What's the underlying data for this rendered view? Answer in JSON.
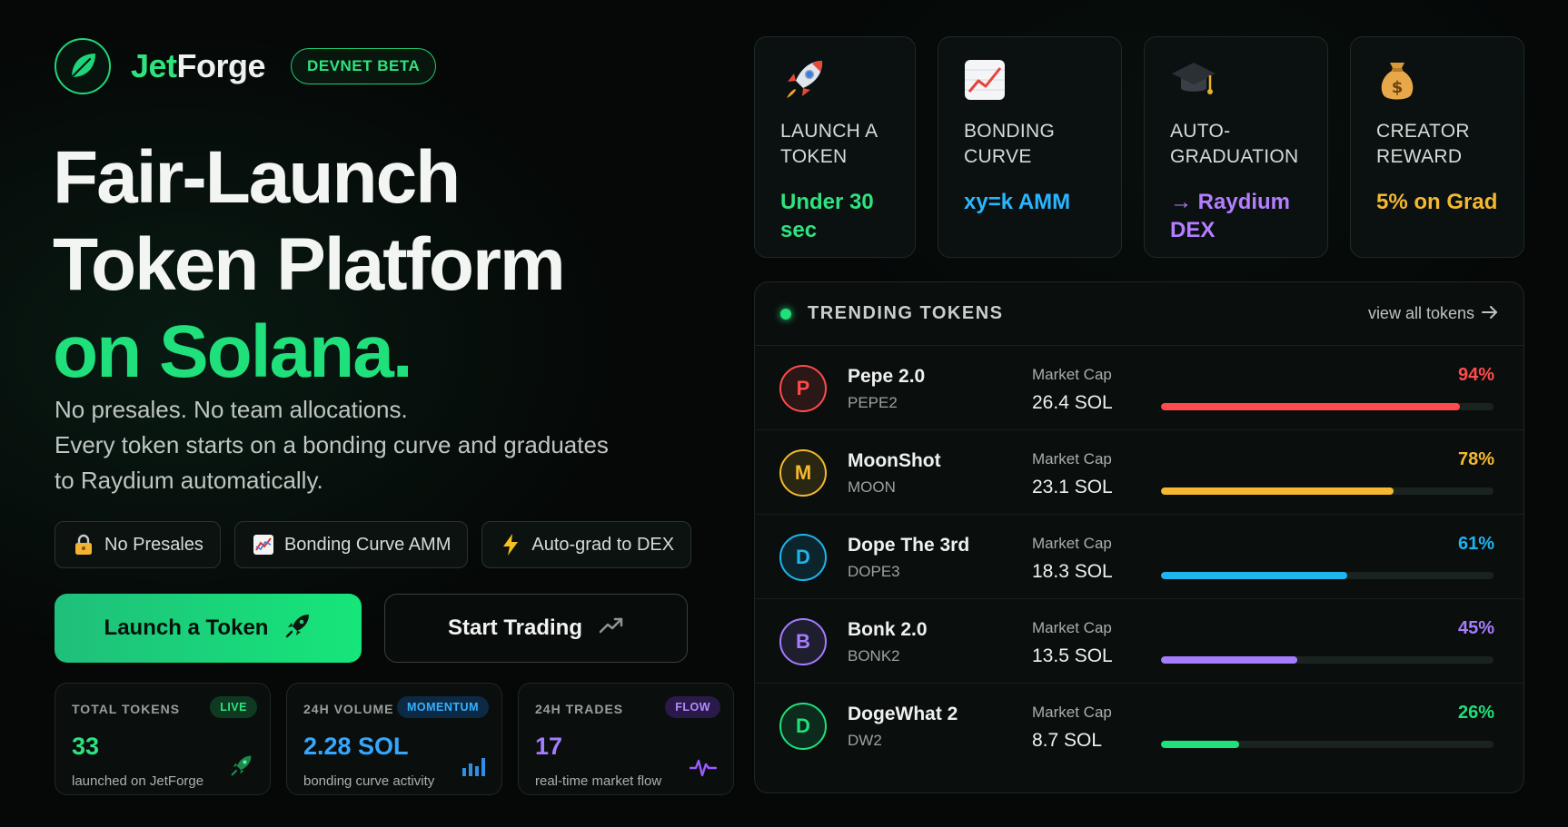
{
  "brand": {
    "name_prefix": "Jet",
    "name_suffix": "Forge",
    "badge": "DEVNET BETA"
  },
  "hero": {
    "line1": "Fair-Launch",
    "line2": "Token Platform",
    "line3": "on Solana.",
    "sub1": "No presales. No team allocations.",
    "sub2": "Every token starts on a bonding curve and graduates to Raydium automatically."
  },
  "chips": [
    {
      "icon": "lock-icon",
      "label": "No Presales"
    },
    {
      "icon": "chart-icon",
      "label": "Bonding Curve AMM"
    },
    {
      "icon": "lightning-icon",
      "label": "Auto-grad to DEX"
    }
  ],
  "cta": {
    "primary": "Launch a Token",
    "secondary": "Start Trading"
  },
  "stats": [
    {
      "label": "TOTAL TOKENS",
      "badge": "LIVE",
      "value": "33",
      "desc": "launched on JetForge",
      "color": "#2ee37f",
      "badge_color": "#2ee37f",
      "badge_bg": "#0f3a22",
      "icon": "rocket-icon"
    },
    {
      "label": "24H VOLUME",
      "badge": "MOMENTUM",
      "value": "2.28 SOL",
      "desc": "bonding curve activity",
      "color": "#36a7ff",
      "badge_color": "#36b0ff",
      "badge_bg": "#0c2a45",
      "icon": "bar-chart-icon"
    },
    {
      "label": "24H TRADES",
      "badge": "FLOW",
      "value": "17",
      "desc": "real-time market flow",
      "color": "#a57cff",
      "badge_color": "#b28cff",
      "badge_bg": "#2a1a4a",
      "icon": "pulse-icon"
    }
  ],
  "features": [
    {
      "icon": "rocket-icon",
      "title": "LAUNCH A TOKEN",
      "value": "Under 30 sec",
      "color": "#2ee37f"
    },
    {
      "icon": "chart-up-icon",
      "title": "BONDING CURVE",
      "value": "xy=k AMM",
      "color": "#2ab6ff"
    },
    {
      "icon": "graduation-cap-icon",
      "title": "AUTO-GRADUATION",
      "value": "→ Raydium DEX",
      "color": "#b57dff"
    },
    {
      "icon": "money-bag-icon",
      "title": "CREATOR REWARD",
      "value": "5% on Grad",
      "color": "#f5b82e"
    }
  ],
  "trending": {
    "title": "TRENDING TOKENS",
    "view_all": "view all tokens",
    "market_cap_label": "Market Cap",
    "tokens": [
      {
        "letter": "P",
        "name": "Pepe 2.0",
        "symbol": "PEPE2",
        "market_cap": "26.4 SOL",
        "percent": "94%",
        "progress": 0.9,
        "color": "#ff4b4b"
      },
      {
        "letter": "M",
        "name": "MoonShot",
        "symbol": "MOON",
        "market_cap": "23.1 SOL",
        "percent": "78%",
        "progress": 0.7,
        "color": "#f5b82e"
      },
      {
        "letter": "D",
        "name": "Dope The 3rd",
        "symbol": "DOPE3",
        "market_cap": "18.3 SOL",
        "percent": "61%",
        "progress": 0.56,
        "color": "#1eb4ee"
      },
      {
        "letter": "B",
        "name": "Bonk 2.0",
        "symbol": "BONK2",
        "market_cap": "13.5 SOL",
        "percent": "45%",
        "progress": 0.41,
        "color": "#a57cff"
      },
      {
        "letter": "D",
        "name": "DogeWhat 2",
        "symbol": "DW2",
        "market_cap": "8.7 SOL",
        "percent": "26%",
        "progress": 0.235,
        "color": "#1fe07a"
      }
    ]
  }
}
